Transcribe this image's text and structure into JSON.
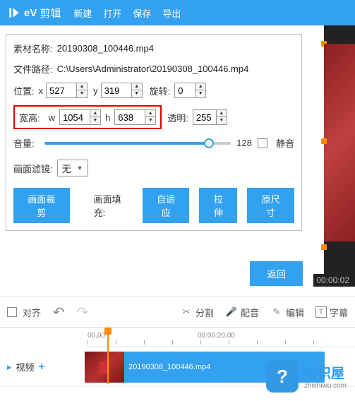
{
  "app": {
    "name": "剪辑"
  },
  "menu": {
    "new": "新建",
    "open": "打开",
    "save": "保存",
    "export": "导出"
  },
  "panel": {
    "name_label": "素材名称:",
    "name_value": "20190308_100446.mp4",
    "path_label": "文件路径:",
    "path_value": "C:\\Users\\Administrator\\20190308_100446.mp4",
    "pos_label": "位置:",
    "x": "x",
    "x_val": "527",
    "y": "y",
    "y_val": "319",
    "rotate_label": "旋转:",
    "rotate_val": "0",
    "size_label": "宽高:",
    "w": "w",
    "w_val": "1054",
    "h": "h",
    "h_val": "638",
    "opacity_label": "透明:",
    "opacity_val": "255",
    "volume_label": "音量:",
    "volume_val": "128",
    "mute_label": "静音",
    "filter_label": "画面滤镜:",
    "filter_val": "无",
    "crop_btn": "画面裁剪",
    "fill_label": "画面填充:",
    "fit_btn": "自适应",
    "stretch_btn": "拉伸",
    "original_btn": "原尺寸"
  },
  "return_btn": "返回",
  "timecode": "00:00:02",
  "toolbar": {
    "align": "对齐",
    "split": "分割",
    "dub": "配音",
    "edit": "编辑",
    "subtitle": "字幕"
  },
  "ruler": {
    "t0": "00,00",
    "t1": "00:00:20,00"
  },
  "track": {
    "video": "视频"
  },
  "clip": {
    "name": "20190308_100446.mp4"
  },
  "watermark": {
    "cn": "知识屋",
    "en": "zhishiwu.com",
    "icon": "?"
  }
}
